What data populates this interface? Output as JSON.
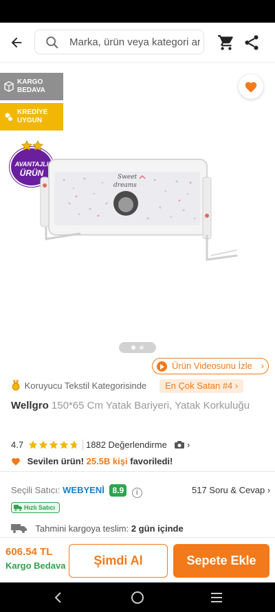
{
  "header": {
    "search_placeholder": "Marka, ürün veya kategori ara",
    "icons": [
      "back-arrow-icon",
      "search-icon",
      "cart-icon",
      "share-icon"
    ]
  },
  "gallery": {
    "badges": {
      "cargo": {
        "line1": "KARGO",
        "line2": "BEDAVA",
        "color": "#8f8f8f"
      },
      "credit": {
        "line1": "KREDİYE",
        "line2": "UYGUN",
        "color": "#f2b705"
      }
    },
    "advantage": {
      "line1": "AVANTAJLI",
      "line2": "ÜRÜN",
      "color": "#6a1f9e"
    },
    "product_print": {
      "line1": "Sweet",
      "line2": "dreams"
    },
    "slides": {
      "total": 2,
      "active": 1
    },
    "video_button": "Ürün Videosunu İzle"
  },
  "product": {
    "category_text": "Koruyucu Tekstil Kategorisinde",
    "best_seller": "En Çok Satan #4",
    "brand": "Wellgro",
    "name": "150*65 Cm Yatak Bariyeri, Yatak Korkuluğu",
    "rating": "4.7",
    "rating_value": 4.7,
    "reviews": "1882 Değerlendirme",
    "favorite_prefix": "Sevilen ürün!",
    "favorite_count": "25.5B kişi",
    "favorite_suffix": "favoriledi!"
  },
  "seller": {
    "label": "Seçili Satıcı:",
    "name": "WEBYENİ",
    "score": "8.9",
    "qa": "517 Soru & Cevap",
    "fast_badge": "Hızlı Satıcı"
  },
  "delivery": {
    "label": "Tahmini kargoya teslim:",
    "value": "2 gün içinde"
  },
  "purchase": {
    "price": "606.54 TL",
    "shipping": "Kargo Bedava",
    "buy_now": "Şimdi Al",
    "add_to_cart": "Sepete Ekle"
  },
  "colors": {
    "accent": "#f27a1a",
    "green": "#2ea44f",
    "link": "#1a7fc6"
  }
}
